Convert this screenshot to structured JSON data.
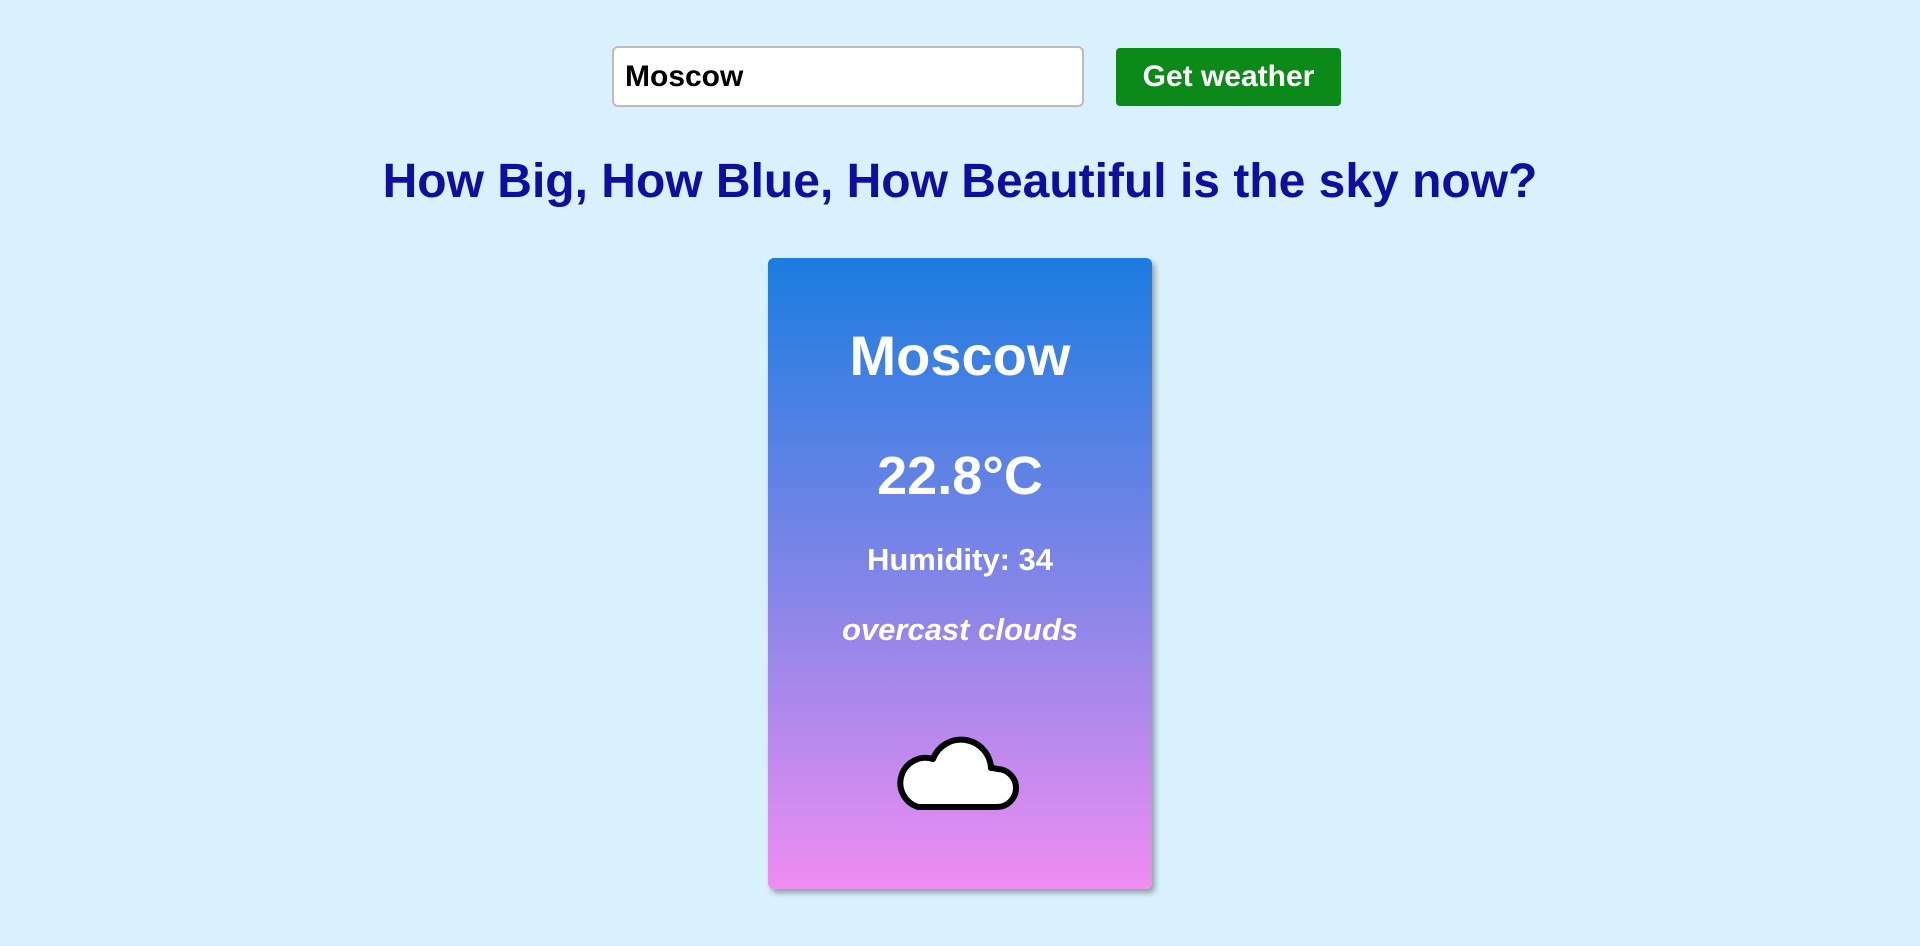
{
  "search": {
    "input_value": "Moscow",
    "button_label": "Get weather"
  },
  "heading": "How Big, How Blue, How Beautiful is the sky now?",
  "weather_card": {
    "city": "Moscow",
    "temperature": "22.8°C",
    "humidity": "Humidity: 34",
    "description": "overcast clouds",
    "icon": "cloud-icon"
  },
  "colors": {
    "background": "#d9f1fd",
    "button": "#0b8a19",
    "heading": "#0e0f9c",
    "card_gradient_top": "#1c7ce0",
    "card_gradient_bottom": "#ef8df2"
  }
}
